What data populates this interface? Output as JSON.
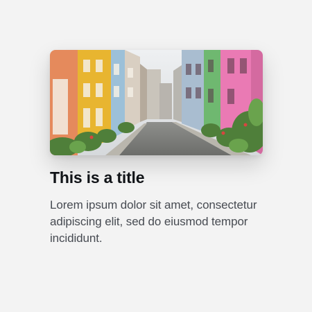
{
  "card": {
    "image_alt": "street-photo",
    "title": "This is a title",
    "description": "Lorem ipsum dolor sit amet, consectetur adipiscing elit, sed do eiusmod tempor incididunt."
  },
  "colors": {
    "background": "#f3f3f3",
    "title": "#111418",
    "description": "#474b52",
    "facade_orange": "#e58a5c",
    "facade_yellow": "#e8b530",
    "facade_blue": "#9cc0d8",
    "facade_green": "#6fb870",
    "facade_pink": "#ea7ab4"
  }
}
